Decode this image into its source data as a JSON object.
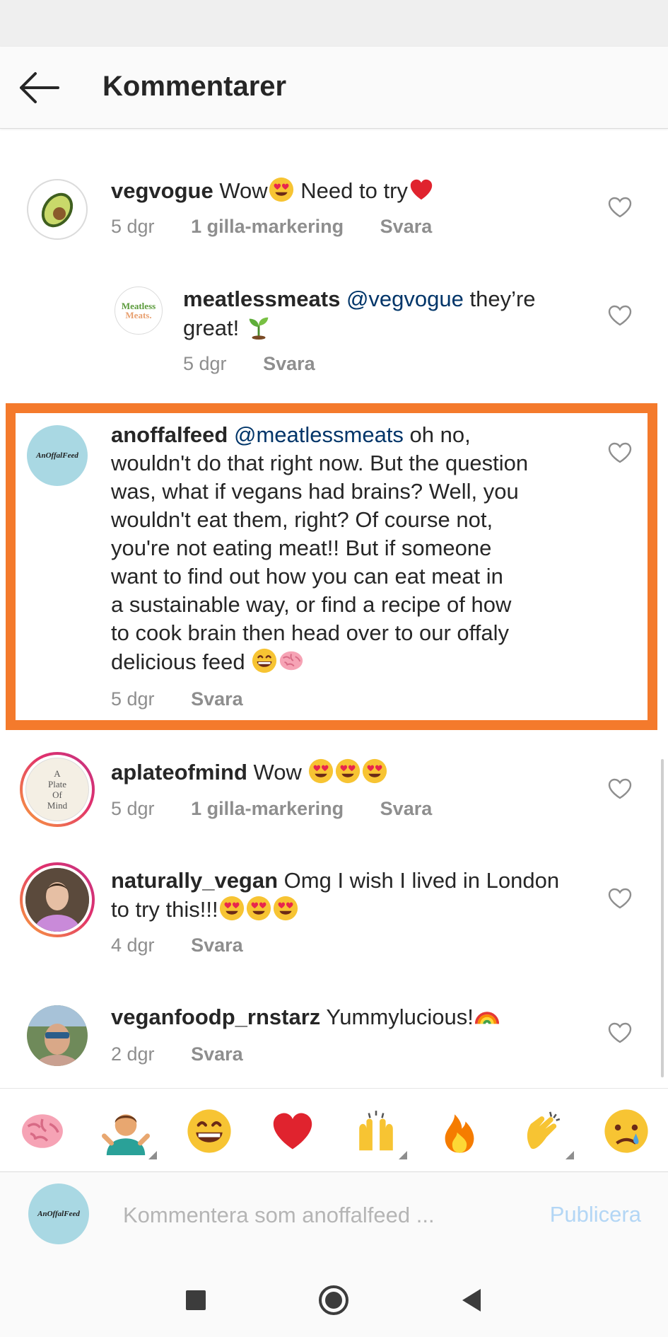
{
  "header": {
    "title": "Kommentarer"
  },
  "comments": [
    {
      "username": "vegvogue",
      "text": "Wow",
      "text2": " Need to try",
      "time": "5 dgr",
      "likes": "1 gilla-markering",
      "reply": "Svara"
    },
    {
      "username": "meatlessmeats",
      "mention": "@vegvogue",
      "text": " they’re",
      "text2": "great!",
      "time": "5 dgr",
      "reply": "Svara",
      "avatar_logo": "Meatless Meats."
    },
    {
      "username": "anoffalfeed",
      "mention": "@meatlessmeats",
      "line1": " oh no,",
      "line2": "wouldn't do that right now. But the question",
      "line3": "was, what if vegans had brains? Well, you",
      "line4": "wouldn't eat them, right? Of course not,",
      "line5": "you're not eating meat!! But if someone",
      "line6": "want to find out how you can eat meat in",
      "line7": "a sustainable way, or find a recipe of how",
      "line8": "to cook brain then head over to our offaly",
      "line9": "delicious feed ",
      "time": "5 dgr",
      "reply": "Svara",
      "avatar_logo": "AnOffalFeed"
    },
    {
      "username": "aplateofmind",
      "text": "Wow ",
      "time": "5 dgr",
      "likes": "1 gilla-markering",
      "reply": "Svara",
      "avatar_logo": "A Plate Of Mind"
    },
    {
      "username": "naturally_vegan",
      "text": "Omg I wish I lived in London",
      "text2": "to try this!!!",
      "time": "4 dgr",
      "reply": "Svara"
    },
    {
      "username": "veganfoodp_rnstarz",
      "text": "Yummylucious!",
      "time": "2 dgr",
      "reply": "Svara"
    }
  ],
  "emoji_bar": [
    "brain-emoji",
    "shrug-emoji",
    "grin-emoji",
    "red-heart-emoji",
    "raising-hands-emoji",
    "fire-emoji",
    "clapping-hands-emoji",
    "crying-face-emoji"
  ],
  "composer": {
    "placeholder": "Kommentera som anoffalfeed ...",
    "publish_label": "Publicera",
    "avatar_logo": "AnOffalFeed"
  },
  "colors": {
    "highlight": "#f47a2c",
    "mention": "#003569",
    "meta": "#8e8e8e",
    "publish": "#b3d6f5"
  }
}
